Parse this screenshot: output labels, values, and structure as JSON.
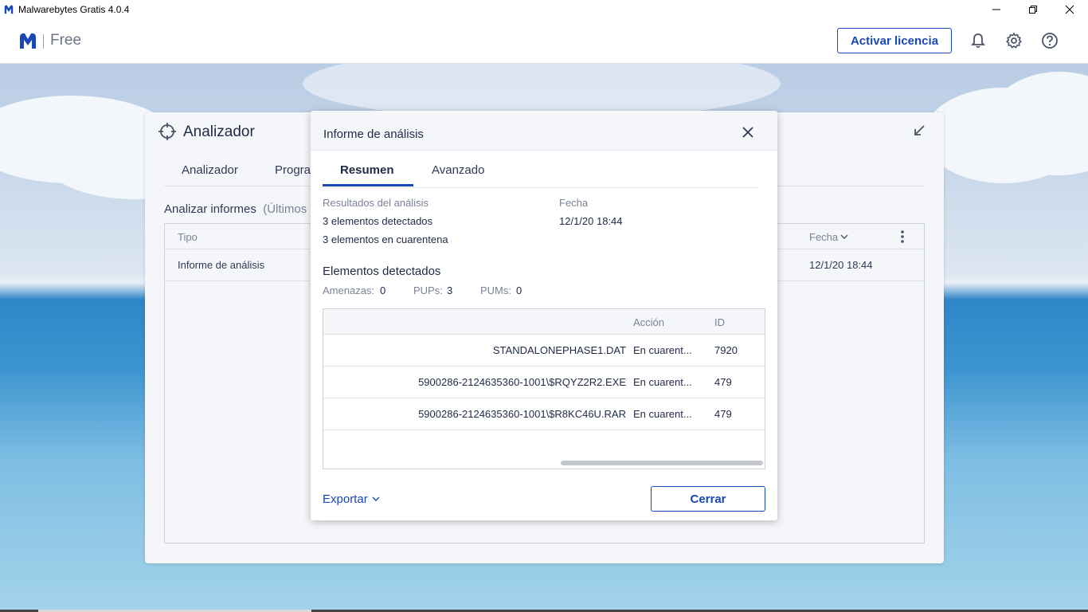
{
  "window": {
    "title": "Malwarebytes Gratis  4.0.4",
    "controls": {
      "minimize": "minimize-icon",
      "restore": "restore-icon",
      "close": "close-icon"
    }
  },
  "header": {
    "edition": "Free",
    "activate_label": "Activar licencia",
    "icons": [
      "bell-icon",
      "gear-icon",
      "help-icon"
    ],
    "accent": "#1748b5"
  },
  "card": {
    "title": "Analizador",
    "tabs": [
      "Analizador",
      "Progra"
    ],
    "subtitle": "Analizar informes",
    "subtitle_muted": "(Últimos",
    "table": {
      "col_type": "Tipo",
      "col_date": "Fecha",
      "rows": [
        {
          "type": "Informe de análisis",
          "date": "12/1/20 18:44"
        }
      ]
    }
  },
  "dialog": {
    "title": "Informe de análisis",
    "tabs": {
      "active": "Resumen",
      "inactive": "Avanzado"
    },
    "results_label": "Resultados del análisis",
    "detected": "3 elementos detectados",
    "quarantined": "3 elementos en cuarentena",
    "date_label": "Fecha",
    "date_value": "12/1/20 18:44",
    "section_title": "Elementos detectados",
    "counts": {
      "threats_label": "Amenazas:",
      "threats": "0",
      "pups_label": "PUPs:",
      "pups": "3",
      "pums_label": "PUMs:",
      "pums": "0"
    },
    "table": {
      "col_action": "Acción",
      "col_id": "ID",
      "rows": [
        {
          "path": "STANDALONEPHASE1.DAT",
          "action": "En cuarent...",
          "id": "7920"
        },
        {
          "path": "5900286-2124635360-1001\\$RQYZ2R2.EXE",
          "action": "En cuarent...",
          "id": "479"
        },
        {
          "path": "5900286-2124635360-1001\\$R8KC46U.RAR",
          "action": "En cuarent...",
          "id": "479"
        }
      ]
    },
    "export_label": "Exportar",
    "close_label": "Cerrar"
  }
}
